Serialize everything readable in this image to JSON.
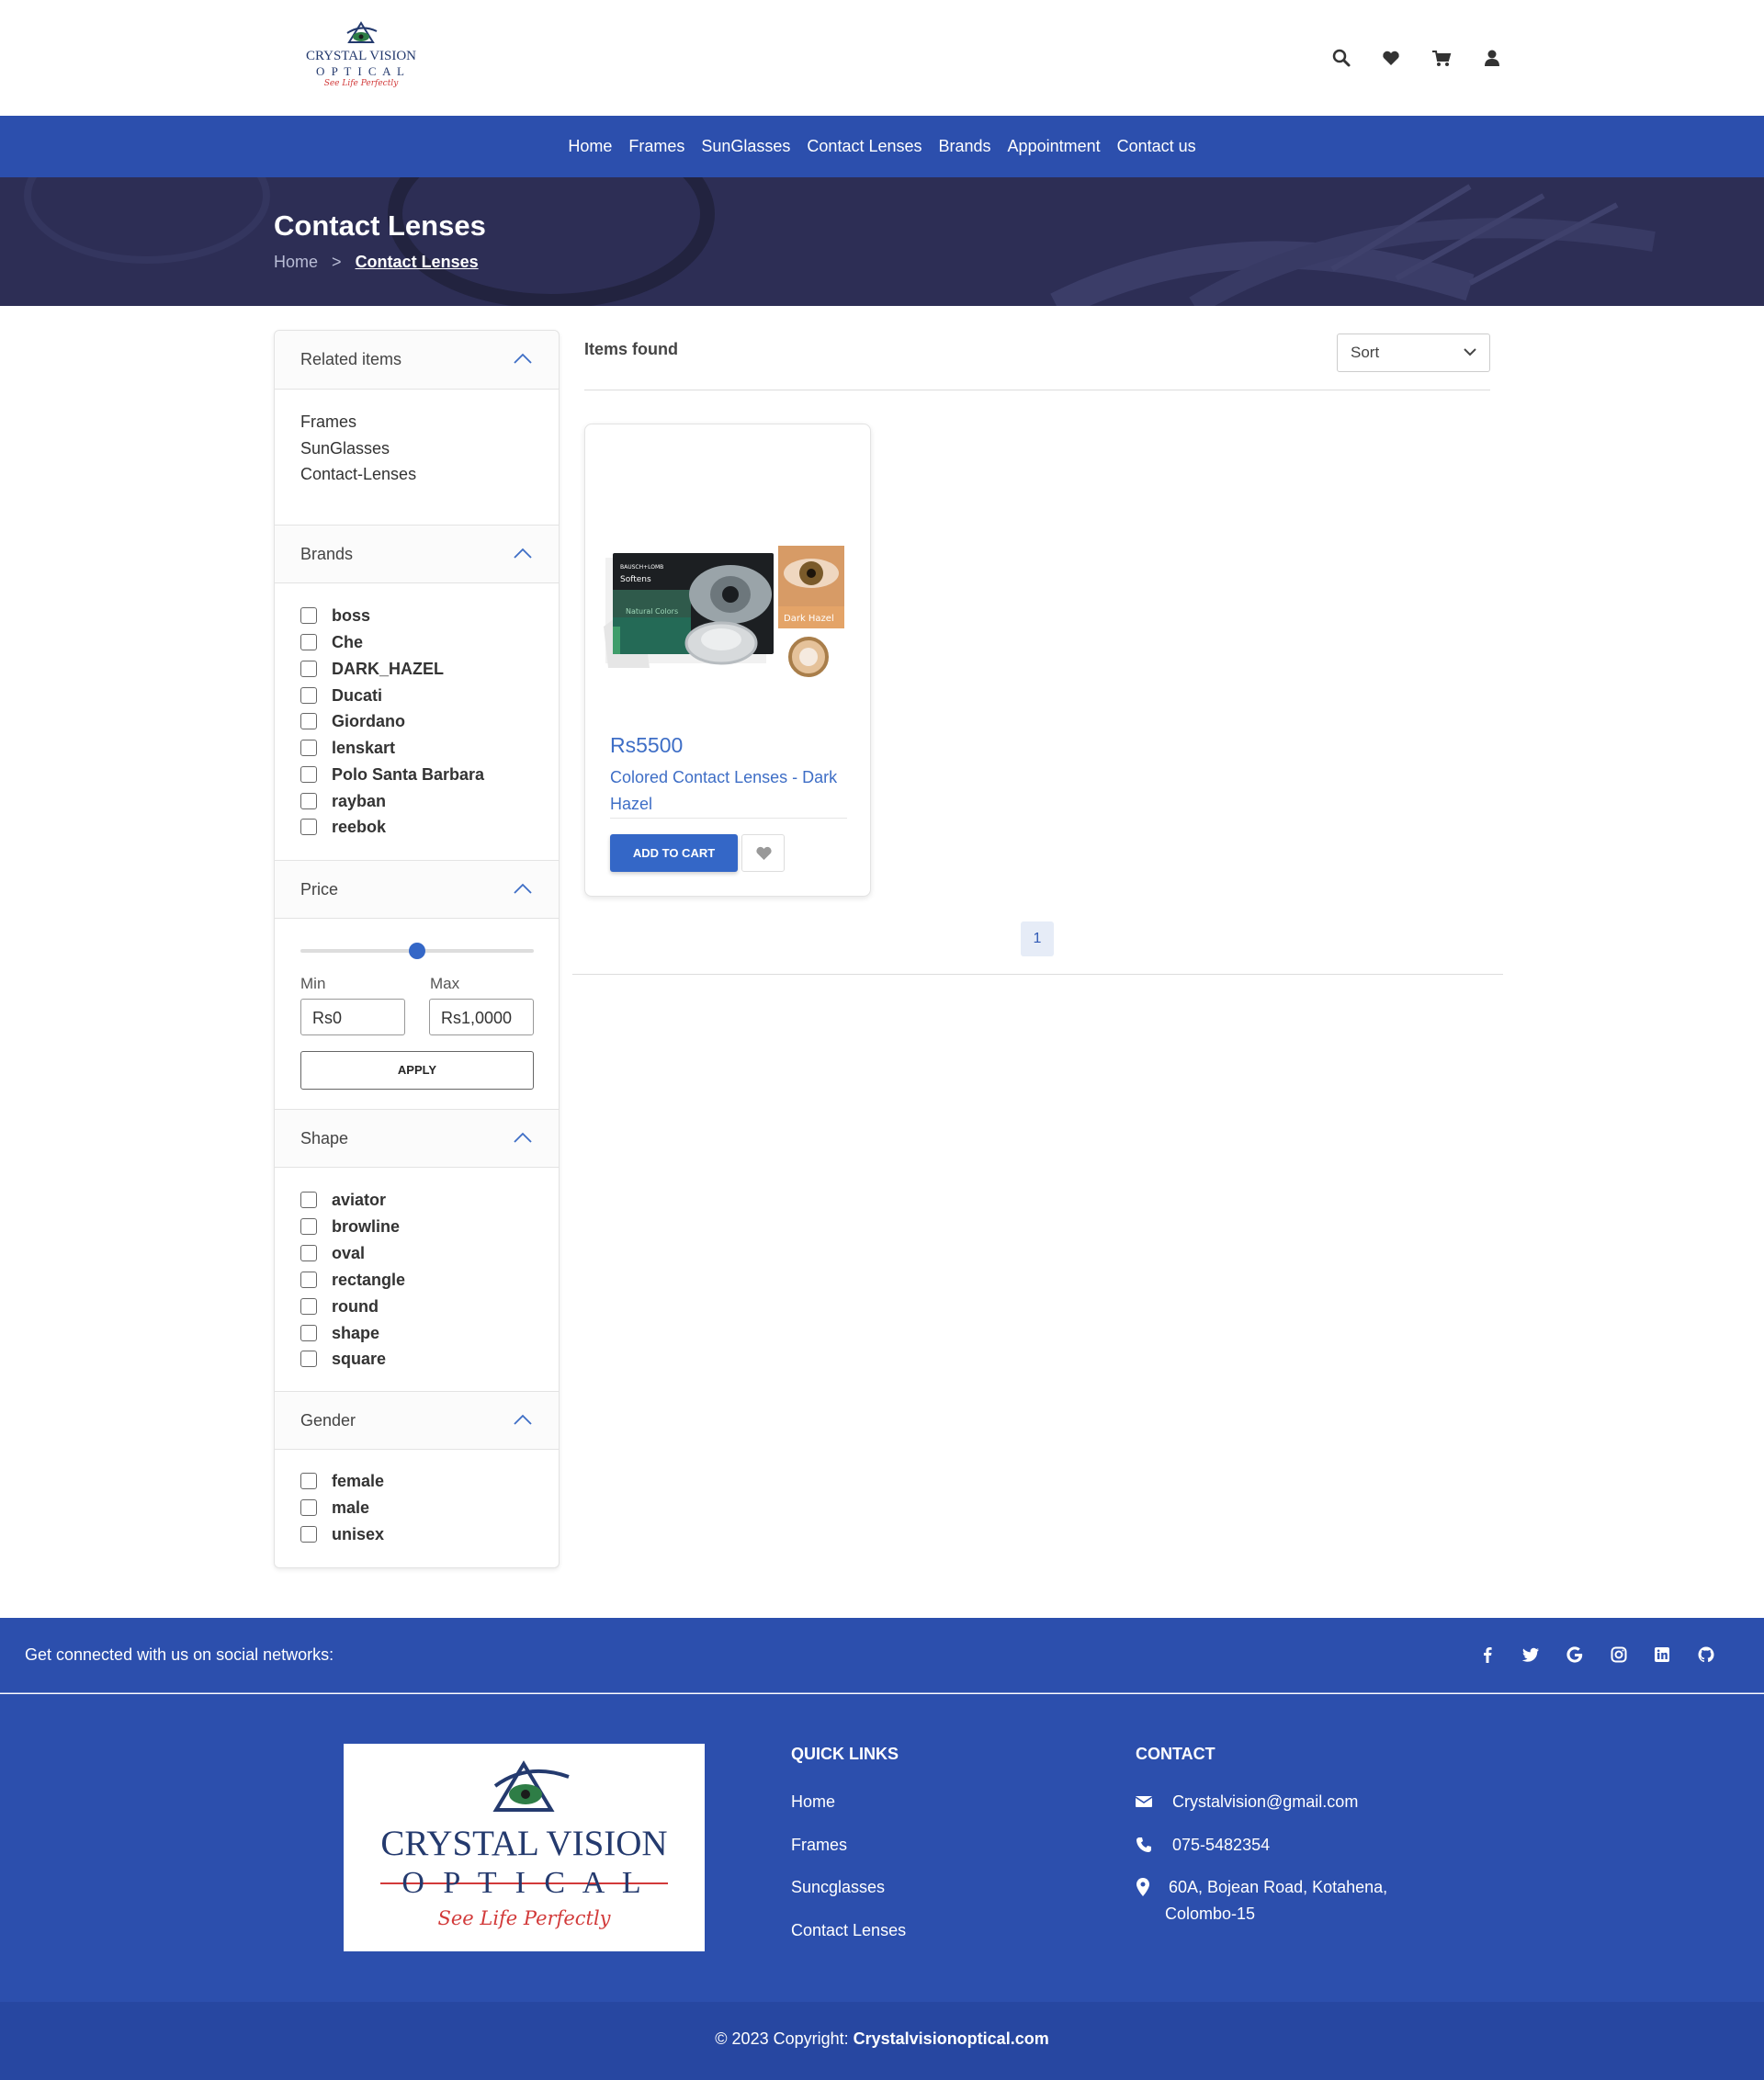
{
  "brand": {
    "name_line1": "CRYSTAL VISION",
    "name_line2": "O P T I C A L",
    "tagline": "See Life Perfectly"
  },
  "header": {
    "icons": [
      "search-icon",
      "heart-icon",
      "cart-icon",
      "user-icon"
    ]
  },
  "nav": {
    "items": [
      "Home",
      "Frames",
      "SunGlasses",
      "Contact Lenses",
      "Brands",
      "Appointment",
      "Contact us"
    ]
  },
  "banner": {
    "title": "Contact Lenses",
    "breadcrumb_home": "Home",
    "breadcrumb_sep": ">",
    "breadcrumb_current": "Contact Lenses"
  },
  "sidebar": {
    "related": {
      "title": "Related items",
      "items": [
        "Frames",
        "SunGlasses",
        "Contact-Lenses"
      ]
    },
    "brands": {
      "title": "Brands",
      "items": [
        "boss",
        "Che",
        "DARK_HAZEL",
        "Ducati",
        "Giordano",
        "lenskart",
        "Polo Santa Barbara",
        "rayban",
        "reebok"
      ]
    },
    "price": {
      "title": "Price",
      "slider_fraction": 0.5,
      "min_label": "Min",
      "max_label": "Max",
      "min_value": "Rs0",
      "max_value": "Rs1,0000",
      "apply_label": "APPLY"
    },
    "shape": {
      "title": "Shape",
      "items": [
        "aviator",
        "browline",
        "oval",
        "rectangle",
        "round",
        "shape",
        "square"
      ]
    },
    "gender": {
      "title": "Gender",
      "items": [
        "female",
        "male",
        "unisex"
      ]
    }
  },
  "main": {
    "items_found": "Items found",
    "sort_label": "Sort",
    "page": "1"
  },
  "product": {
    "price": "Rs5500",
    "name": "Colored Contact Lenses - Dark Hazel",
    "add_to_cart": "ADD TO CART",
    "image_text": {
      "brand": "BAUSCH+LOMB",
      "product": "Softens",
      "line": "Natural Colors",
      "shade": "Dark Hazel"
    }
  },
  "social": {
    "text": "Get connected with us on social networks:",
    "icons": [
      "facebook-icon",
      "twitter-icon",
      "google-icon",
      "instagram-icon",
      "linkedin-icon",
      "github-icon"
    ]
  },
  "footer": {
    "quick_links_title": "QUICK LINKS",
    "quick_links": [
      "Home",
      "Frames",
      "Suncglasses",
      "Contact Lenses"
    ],
    "contact_title": "CONTACT",
    "email": "Crystalvision@gmail.com",
    "phone": "075-5482354",
    "address_line1": "60A, Bojean Road, Kotahena,",
    "address_line2": "Colombo-15",
    "copyright_prefix": "© 2023 Copyright: ",
    "copyright_site": "Crystalvisionoptical.com"
  },
  "colors": {
    "primary": "#2c4fad",
    "accent": "#3e6ec6",
    "banner": "#2d2e55"
  }
}
